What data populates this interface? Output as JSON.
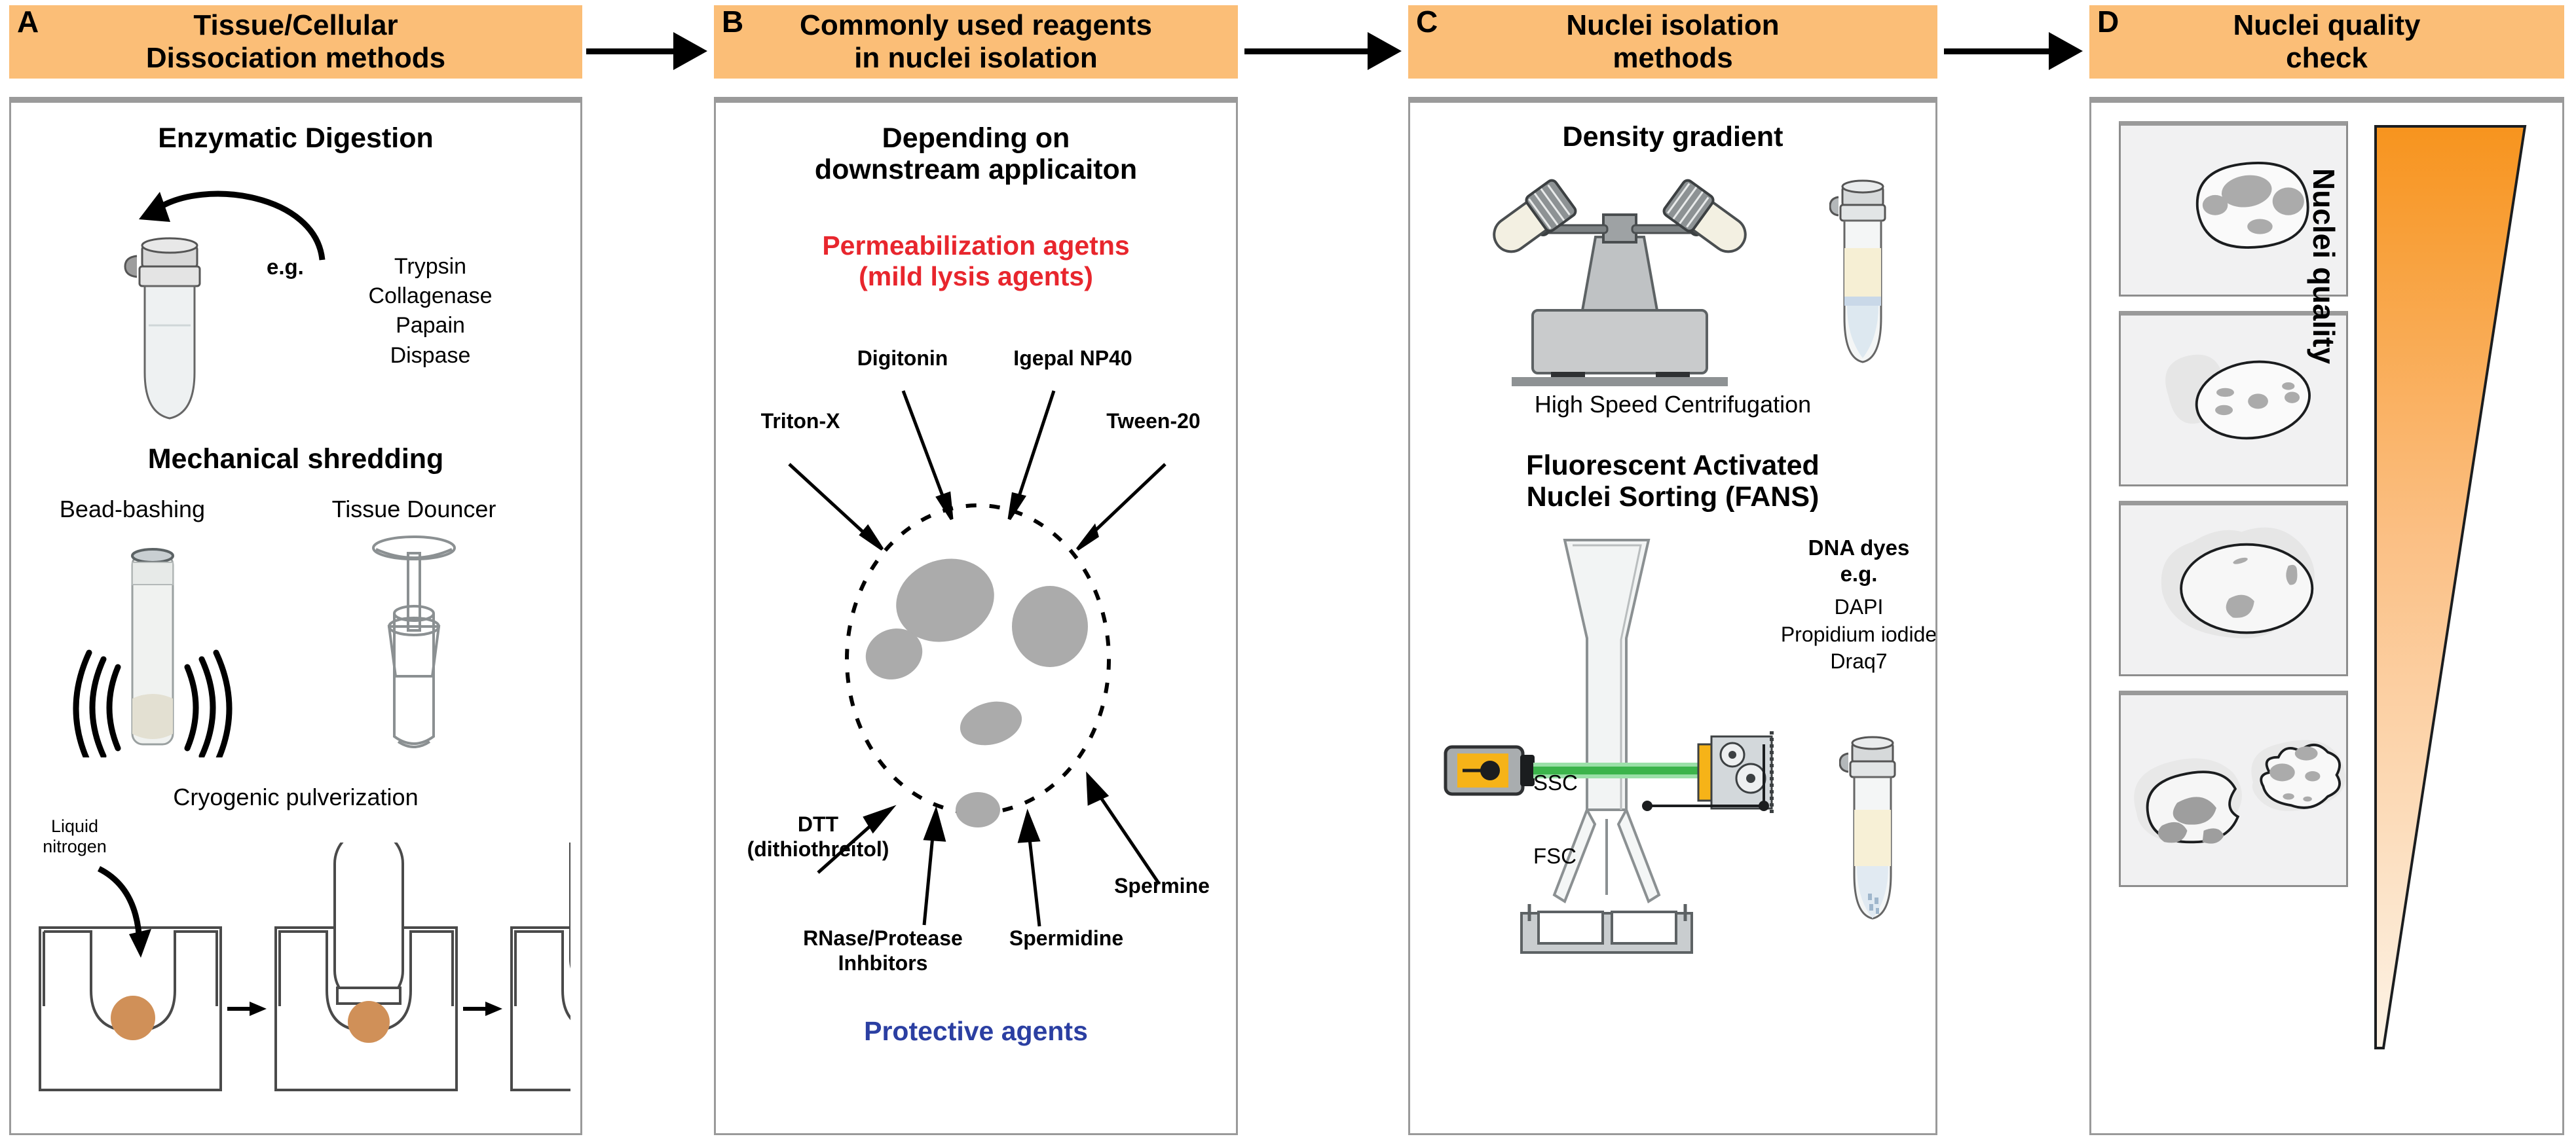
{
  "panels": [
    {
      "letter": "A",
      "title": "Tissue/Cellular\nDissociation methods",
      "sections": {
        "enzymatic_title": "Enzymatic Digestion",
        "eg_label": "e.g.",
        "enzymes": "Trypsin\nCollagenase\nPapain\nDispase",
        "mechanical_title": "Mechanical shredding",
        "bead_label": "Bead-bashing",
        "douncer_label": "Tissue Douncer",
        "cryo_title": "Cryogenic pulverization",
        "liquid_nitrogen": "Liquid\nnitrogen"
      }
    },
    {
      "letter": "B",
      "title": "Commonly used reagents\nin nuclei isolation",
      "sections": {
        "depending": "Depending on\ndownstream applicaiton",
        "permeabilization": "Permeabilization agetns\n(mild lysis agents)",
        "protective": "Protective agents",
        "reagents": [
          "Digitonin",
          "Igepal NP40",
          "Triton-X",
          "Tween-20",
          "DTT\n(dithiothreitol)",
          "RNase/Protease\nInhbitors",
          "Spermidine",
          "Spermine"
        ]
      }
    },
    {
      "letter": "C",
      "title": "Nuclei isolation\nmethods",
      "sections": {
        "density_title": "Density gradient",
        "centrifugation_label": "High Speed Centrifugation",
        "fans_title": "Fluorescent Activated\nNuclei Sorting (FANS)",
        "ssc_label": "SSC",
        "fsc_label": "FSC",
        "dye_header": "DNA dyes\ne.g.",
        "dyes": "DAPI\nPropidium iodide\nDraq7"
      }
    },
    {
      "letter": "D",
      "title": "Nuclei quality\ncheck",
      "sections": {
        "wedge_label": "Nuclei quality"
      }
    }
  ],
  "colors": {
    "banner": "#FBBE77",
    "permeabilization_text": "#E8262D",
    "protective_text": "#2B3FA2",
    "wedge_top": "#F7941E",
    "wedge_bottom": "#FDF0E0",
    "nucleus_blob": "#ABABAB",
    "cryo_sample": "#D09058",
    "laser_body": "#F6B318",
    "laser_beam": "#3CB44B",
    "box_border": "#9a9a9a"
  }
}
